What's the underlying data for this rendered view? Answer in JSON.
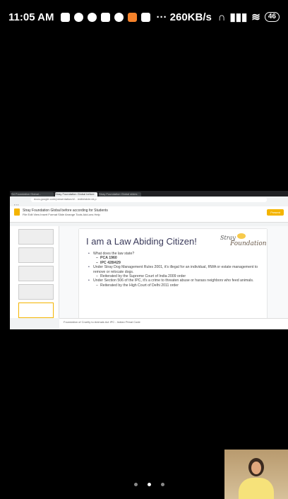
{
  "status_bar": {
    "time": "11:05 AM",
    "speed": "··· 260KB/s",
    "battery": "46"
  },
  "browser": {
    "tabs": [
      "Sri Foundation Global...",
      "Stray Foundation Global before",
      "Stray Foundation Global slides"
    ],
    "address": "docs.google.com/presentation/d/…/edit#slide=id.p"
  },
  "slides_app": {
    "doc_title": "Stray Foundation Global before according for Students",
    "menus": "File  Edit  View  Insert  Format  Slide  Arrange  Tools  Add-ons  Help",
    "present_label": "Present"
  },
  "slide": {
    "title": "I am a Law Abiding Citizen!",
    "logo_line1": "Stray",
    "logo_line2": "Foundation",
    "bullets": [
      {
        "level": 1,
        "text": "What does the law state?"
      },
      {
        "level": 2,
        "text": "PCA 1960"
      },
      {
        "level": 2,
        "text": "IPC 428/429"
      },
      {
        "level": 1,
        "text": "Under Stray Dog Management Rules 2001, it's illegal for an individual, RWA or estate management to remove or relocate dogs."
      },
      {
        "level": 3,
        "text": "Reiterated by the Supreme Court of India 2009 order"
      },
      {
        "level": 1,
        "text": "Under Section 506 of the IPC, it's a crime to threaten abuse or harass neighbors who feed animals."
      },
      {
        "level": 3,
        "text": "Reiterated by the High Court of Delhi 2011 order"
      }
    ]
  },
  "speaker_notes": "Foundation of Cruelty to Animals Act\nIPC - Indian Penal Code",
  "colors": {
    "accent": "#f4b400",
    "title": "#3a3a5a"
  }
}
